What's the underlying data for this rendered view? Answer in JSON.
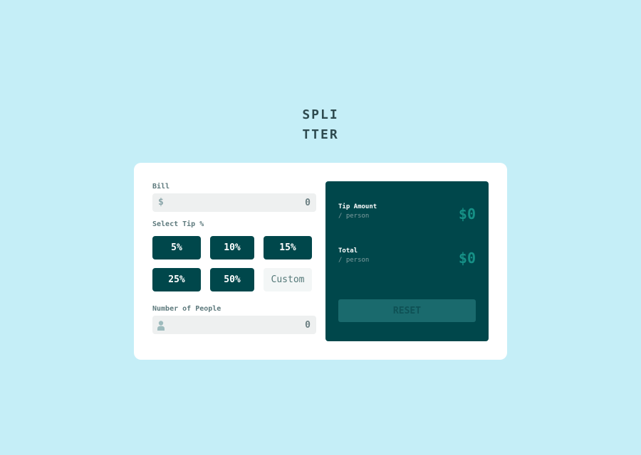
{
  "logo": {
    "line1": "SPLI",
    "line2": "TTER"
  },
  "bill": {
    "label": "Bill",
    "icon": "dollar-icon",
    "icon_glyph": "$",
    "value": "0"
  },
  "tip": {
    "label": "Select Tip %",
    "options": [
      "5%",
      "10%",
      "15%",
      "25%",
      "50%"
    ],
    "custom_placeholder": "Custom"
  },
  "people": {
    "label": "Number of People",
    "icon": "person-icon",
    "value": "0"
  },
  "result": {
    "tip_label": "Tip Amount",
    "tip_sub": "/ person",
    "tip_value": "$0",
    "total_label": "Total",
    "total_sub": "/ person",
    "total_value": "$0",
    "reset_label": "RESET"
  },
  "colors": {
    "background": "#c5eef7",
    "panel": "#00474b",
    "accent": "#26c2ae"
  }
}
